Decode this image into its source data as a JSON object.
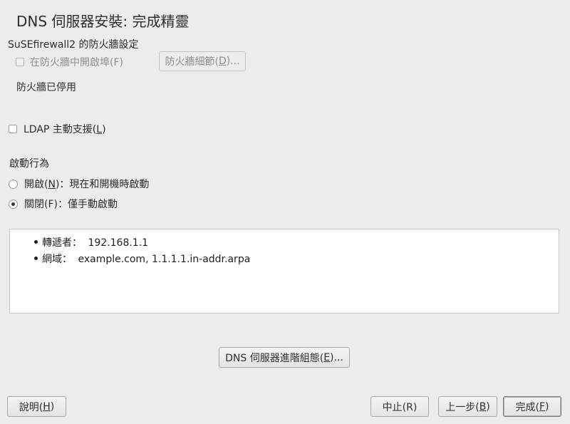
{
  "window": {
    "title": "DNS 伺服器安裝: 完成精靈"
  },
  "firewall": {
    "section_label": "SuSEfirewall2 的防火牆設定",
    "open_port_label": "在防火牆中開啟埠(F)",
    "details_button": {
      "pre": "防火牆細節(",
      "mnemonic": "D",
      "post": ")..."
    },
    "status_text": "防火牆已停用"
  },
  "ldap": {
    "label_pre": "LDAP 主動支援(",
    "mnemonic": "L",
    "label_post": ")",
    "checked": false
  },
  "startup": {
    "heading": "啟動行為",
    "on": {
      "pre": "開啟(",
      "mnemonic": "N",
      "post": ")：現在和開機時啟動",
      "checked": false
    },
    "off": {
      "label": "關閉(F)：僅手動啟動",
      "checked": true
    }
  },
  "summary": {
    "items": [
      {
        "key": "轉遞者：",
        "value": "192.168.1.1"
      },
      {
        "key": "網域：",
        "value": "example.com, 1.1.1.1.in-addr.arpa"
      }
    ]
  },
  "buttons": {
    "advanced": {
      "pre": "DNS 伺服器進階組態(",
      "mnemonic": "E",
      "post": ")..."
    },
    "help": {
      "pre": "說明(",
      "mnemonic": "H",
      "post": ")"
    },
    "abort": "中止(R)",
    "back": {
      "pre": "上一步(",
      "mnemonic": "B",
      "post": ")"
    },
    "finish": {
      "pre": "完成(",
      "mnemonic": "F",
      "post": ")"
    }
  }
}
